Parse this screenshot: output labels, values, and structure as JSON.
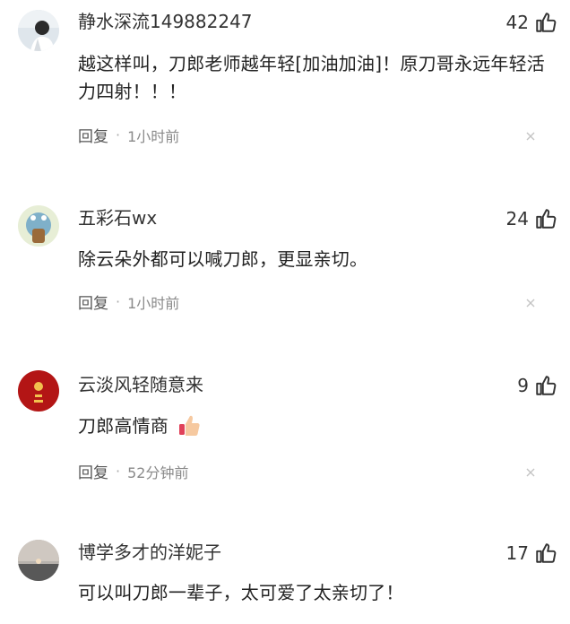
{
  "comments": [
    {
      "username": "静水深流149882247",
      "likes": "42",
      "text": "越这样叫，刀郎老师越年轻[加油加油]！原刀哥永远年轻活力四射！！！",
      "reply_label": "回复",
      "separator": "·",
      "time": "1小时前"
    },
    {
      "username": "五彩石wx",
      "likes": "24",
      "text": "除云朵外都可以喊刀郎，更显亲切。",
      "reply_label": "回复",
      "separator": "·",
      "time": "1小时前"
    },
    {
      "username": "云淡风轻随意来",
      "likes": "9",
      "text": "刀郎高情商",
      "reply_label": "回复",
      "separator": "·",
      "time": "52分钟前"
    },
    {
      "username": "博学多才的洋妮子",
      "likes": "17",
      "text": "可以叫刀郎一辈子，太可爱了太亲切了！"
    }
  ],
  "icons": {
    "like": "thumbs-up-icon",
    "close": "close-icon",
    "reaction": "thumbs-up-emoji"
  },
  "colors": {
    "text": "#222222",
    "muted": "#8a8a8a",
    "separator": "#aaaaaa"
  }
}
